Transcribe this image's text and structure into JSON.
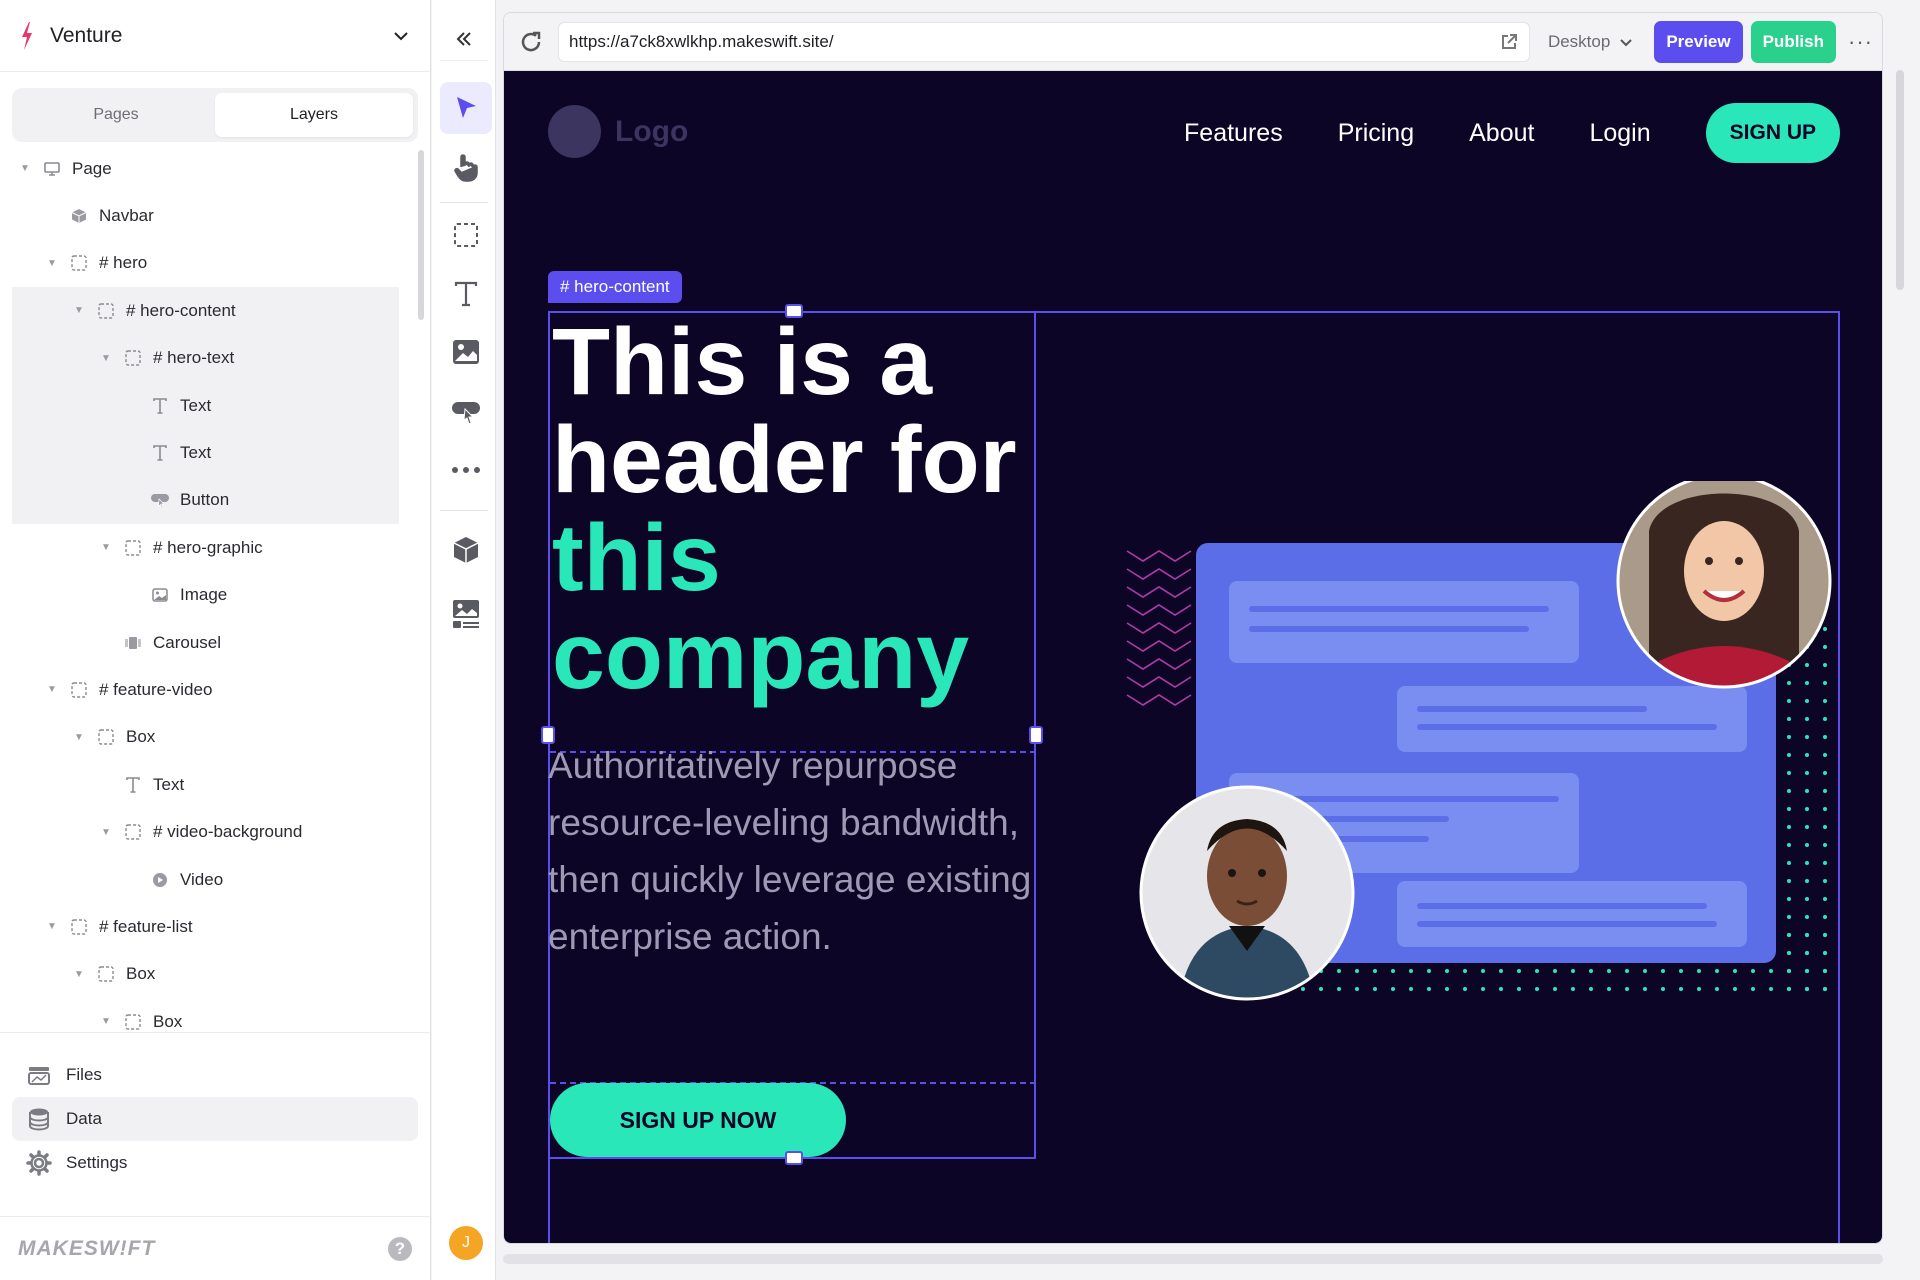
{
  "site_switcher": {
    "name": "Venture"
  },
  "panel_tabs": [
    {
      "label": "Pages",
      "active": false
    },
    {
      "label": "Layers",
      "active": true
    }
  ],
  "layers": [
    {
      "label": "Page",
      "depth": 0,
      "icon": "monitor-icon",
      "caret": true,
      "selected": false
    },
    {
      "label": "Navbar",
      "depth": 1,
      "icon": "component-icon",
      "caret": false,
      "selected": false
    },
    {
      "label": "# hero",
      "depth": 1,
      "icon": "box-icon",
      "caret": true,
      "selected": false
    },
    {
      "label": "# hero-content",
      "depth": 2,
      "icon": "box-icon",
      "caret": true,
      "selected": true
    },
    {
      "label": "# hero-text",
      "depth": 3,
      "icon": "box-icon",
      "caret": true,
      "selected": true
    },
    {
      "label": "Text",
      "depth": 4,
      "icon": "text-icon",
      "caret": false,
      "selected": true
    },
    {
      "label": "Text",
      "depth": 4,
      "icon": "text-icon",
      "caret": false,
      "selected": true
    },
    {
      "label": "Button",
      "depth": 4,
      "icon": "button-icon",
      "caret": false,
      "selected": true
    },
    {
      "label": "# hero-graphic",
      "depth": 3,
      "icon": "box-icon",
      "caret": true,
      "selected": false
    },
    {
      "label": "Image",
      "depth": 4,
      "icon": "image-icon",
      "caret": false,
      "selected": false
    },
    {
      "label": "Carousel",
      "depth": 3,
      "icon": "carousel-icon",
      "caret": false,
      "selected": false
    },
    {
      "label": "# feature-video",
      "depth": 1,
      "icon": "box-icon",
      "caret": true,
      "selected": false
    },
    {
      "label": "Box",
      "depth": 2,
      "icon": "box-icon",
      "caret": true,
      "selected": false
    },
    {
      "label": "Text",
      "depth": 3,
      "icon": "text-icon",
      "caret": false,
      "selected": false
    },
    {
      "label": "# video-background",
      "depth": 3,
      "icon": "box-icon",
      "caret": true,
      "selected": false
    },
    {
      "label": "Video",
      "depth": 4,
      "icon": "video-icon",
      "caret": false,
      "selected": false
    },
    {
      "label": "# feature-list",
      "depth": 1,
      "icon": "box-icon",
      "caret": true,
      "selected": false
    },
    {
      "label": "Box",
      "depth": 2,
      "icon": "box-icon",
      "caret": true,
      "selected": false
    },
    {
      "label": "Box",
      "depth": 3,
      "icon": "box-icon",
      "caret": true,
      "selected": false
    }
  ],
  "bottom_nav": [
    {
      "label": "Files",
      "icon": "files-icon",
      "active": false
    },
    {
      "label": "Data",
      "icon": "database-icon",
      "active": true
    },
    {
      "label": "Settings",
      "icon": "gear-icon",
      "active": false
    }
  ],
  "footer": {
    "brand": "MAKESW!FT",
    "help": "?"
  },
  "user": {
    "initial": "J"
  },
  "tools": [
    {
      "name": "select-tool",
      "icon": "cursor-arrow-icon",
      "active": true
    },
    {
      "name": "hand-tool",
      "icon": "hand-icon",
      "active": false
    },
    {
      "name": "box-tool",
      "icon": "dashed-box-icon",
      "active": false
    },
    {
      "name": "text-tool",
      "icon": "text-icon",
      "active": false
    },
    {
      "name": "image-tool",
      "icon": "image-icon",
      "active": false
    },
    {
      "name": "button-tool",
      "icon": "button-icon",
      "active": false
    },
    {
      "name": "more-tools",
      "icon": "ellipsis-icon",
      "active": false
    },
    {
      "name": "components-tool",
      "icon": "cube-icon",
      "active": false
    },
    {
      "name": "gallery-tool",
      "icon": "gallery-icon",
      "active": false
    }
  ],
  "browser": {
    "url": "https://a7ck8xwlkhp.makeswift.site/",
    "device": "Desktop",
    "preview_label": "Preview",
    "publish_label": "Publish",
    "more_label": "···"
  },
  "site": {
    "logo_text": "Logo",
    "nav_links": [
      "Features",
      "Pricing",
      "About",
      "Login"
    ],
    "signup_label": "SIGN UP",
    "selection_tag": "# hero-content",
    "headline_white": "This is a header for",
    "headline_accent": "this company",
    "subheadline": "Authoritatively repurpose resource-leveling bandwidth, then quickly leverage existing enterprise action.",
    "cta_label": "SIGN UP NOW"
  },
  "colors": {
    "accent": "#5b4dee",
    "publish": "#2ad18c",
    "site_bg": "#0c0526",
    "site_accent": "#2ae7b9",
    "card": "#5b6ee8"
  }
}
